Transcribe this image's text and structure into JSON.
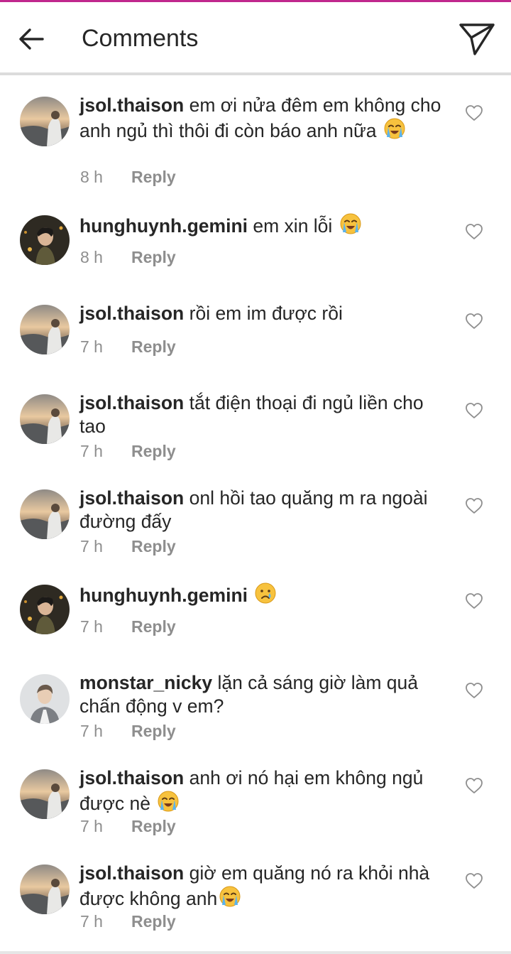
{
  "header": {
    "title": "Comments",
    "back_icon": "arrow-left-icon",
    "send_icon": "paper-plane-icon"
  },
  "colors": {
    "accent_strip": "#c0278d",
    "text": "#262626",
    "muted": "#8e8e8e"
  },
  "comments": [
    {
      "username": "jsol.thaison",
      "text": "em ơi nửa đêm em không cho anh ngủ thì thôi đi còn báo anh nữa",
      "emoji": "loudly-crying-face",
      "time": "8 h",
      "reply_label": "Reply",
      "avatar": "sunset-avatar"
    },
    {
      "username": "hunghuynh.gemini",
      "text": "em xin lỗi",
      "emoji": "loudly-crying-face",
      "time": "8 h",
      "reply_label": "Reply",
      "avatar": "dark-portrait-avatar"
    },
    {
      "username": "jsol.thaison",
      "text": "rồi em im được rồi",
      "emoji": "",
      "time": "7 h",
      "reply_label": "Reply",
      "avatar": "sunset-avatar"
    },
    {
      "username": "jsol.thaison",
      "text": "tắt điện thoại đi ngủ liền cho tao",
      "emoji": "",
      "time": "7 h",
      "reply_label": "Reply",
      "avatar": "sunset-avatar"
    },
    {
      "username": "jsol.thaison",
      "text": "onl hồi tao quăng m ra ngoài đường đấy",
      "emoji": "",
      "time": "7 h",
      "reply_label": "Reply",
      "avatar": "sunset-avatar"
    },
    {
      "username": "hunghuynh.gemini",
      "text": "",
      "emoji": "crying-face",
      "time": "7 h",
      "reply_label": "Reply",
      "avatar": "dark-portrait-avatar"
    },
    {
      "username": "monstar_nicky",
      "text": "lặn cả sáng giờ làm quả chấn động v em?",
      "emoji": "",
      "time": "7 h",
      "reply_label": "Reply",
      "avatar": "grey-portrait-avatar"
    },
    {
      "username": "jsol.thaison",
      "text": "anh ơi nó hại em không ngủ được nè",
      "emoji": "loudly-crying-face",
      "time": "7 h",
      "reply_label": "Reply",
      "avatar": "sunset-avatar"
    },
    {
      "username": "jsol.thaison",
      "text": "giờ em quăng nó ra khỏi nhà được không anh",
      "emoji": "loudly-crying-face",
      "time": "7 h",
      "reply_label": "Reply",
      "avatar": "sunset-avatar"
    }
  ]
}
